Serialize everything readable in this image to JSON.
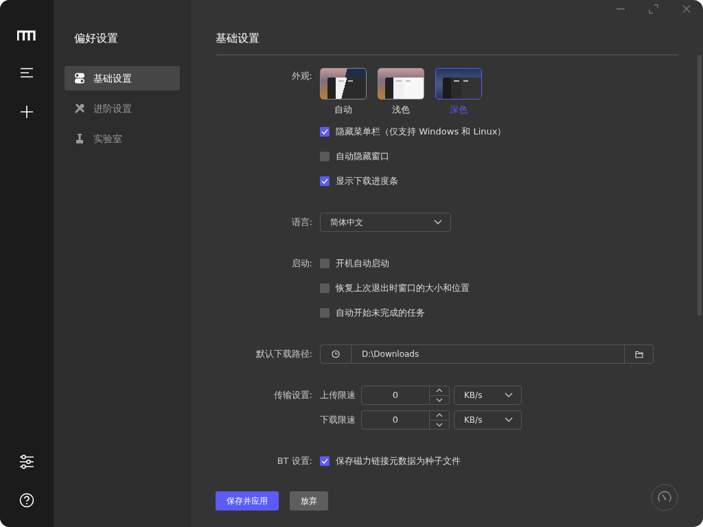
{
  "sidebar": {
    "title": "偏好设置",
    "items": [
      {
        "label": "基础设置",
        "selected": true
      },
      {
        "label": "进阶设置",
        "selected": false
      },
      {
        "label": "实验室",
        "selected": false
      }
    ]
  },
  "main": {
    "title": "基础设置",
    "appearance": {
      "label": "外观:",
      "themes": [
        {
          "label": "自动",
          "kind": "auto",
          "selected": false
        },
        {
          "label": "浅色",
          "kind": "light",
          "selected": false
        },
        {
          "label": "深色",
          "kind": "dark",
          "selected": true
        }
      ],
      "options": [
        {
          "label": "隐藏菜单栏（仅支持 Windows 和 Linux）",
          "checked": true
        },
        {
          "label": "自动隐藏窗口",
          "checked": false
        },
        {
          "label": "显示下载进度条",
          "checked": true
        }
      ]
    },
    "language": {
      "label": "语言:",
      "value": "简体中文"
    },
    "startup": {
      "label": "启动:",
      "options": [
        {
          "label": "开机自动启动",
          "checked": false
        },
        {
          "label": "恢复上次退出时窗口的大小和位置",
          "checked": false
        },
        {
          "label": "自动开始未完成的任务",
          "checked": false
        }
      ]
    },
    "download_path": {
      "label": "默认下载路径:",
      "value": "D:\\Downloads"
    },
    "transfer": {
      "label": "传输设置:",
      "rows": [
        {
          "label": "上传限速",
          "value": "0",
          "unit": "KB/s"
        },
        {
          "label": "下载限速",
          "value": "0",
          "unit": "KB/s"
        }
      ]
    },
    "bt": {
      "label": "BT 设置:",
      "options": [
        {
          "label": "保存磁力链接元数据为种子文件",
          "checked": true
        }
      ]
    },
    "buttons": [
      {
        "label": "保存并应用",
        "kind": "primary"
      },
      {
        "label": "放弃",
        "kind": "secondary"
      }
    ]
  }
}
